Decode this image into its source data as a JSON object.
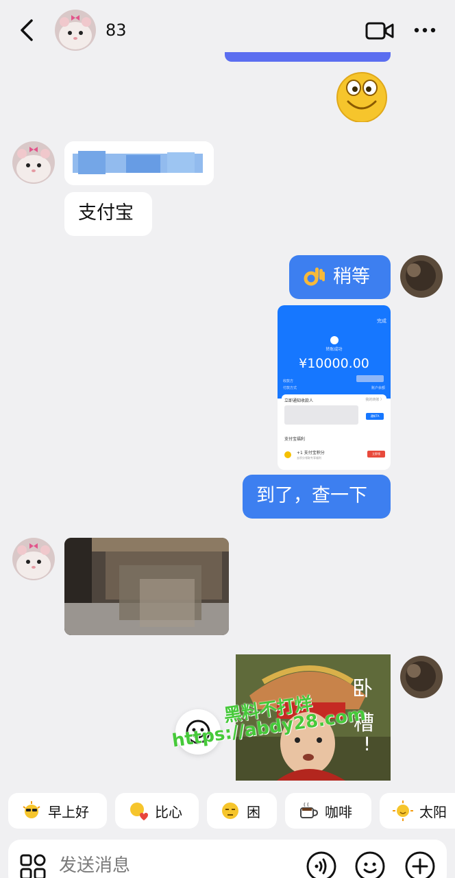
{
  "header": {
    "title": "83"
  },
  "messages": {
    "alipay_text": "支付宝",
    "wait_text": "稍等",
    "wait_emoji": "ok-hand",
    "receipt": {
      "done": "完成",
      "status": "转账成功",
      "amount": "¥10000.00",
      "payee_label": "收款方",
      "method_label": "付款方式",
      "method_value": "账户余额",
      "notify_title": "立即通知收款人",
      "notify_link": "我的转账 〉",
      "notify_button": "通知TA",
      "benefit_title": "支付宝福利",
      "benefit_text": "+1 支付宝积分",
      "benefit_sub": "去积分领取专享福利",
      "benefit_button": "立即领"
    },
    "arrived_text": "到了，查一下"
  },
  "watermark": {
    "line1": "黑料不打烊",
    "line2": "https://abdy28.com"
  },
  "quick_replies": [
    {
      "label": "早上好",
      "icon": "sun-sunglasses-icon"
    },
    {
      "label": "比心",
      "icon": "heart-hands-icon"
    },
    {
      "label": "困",
      "icon": "sleepy-face-icon"
    },
    {
      "label": "咖啡",
      "icon": "coffee-icon"
    },
    {
      "label": "太阳",
      "icon": "sun-icon"
    }
  ],
  "input": {
    "placeholder": "发送消息"
  },
  "colors": {
    "background": "#f0f0f2",
    "my_bubble": "#3d7ff0",
    "their_bubble": "#ffffff",
    "watermark": "#46c93a"
  }
}
